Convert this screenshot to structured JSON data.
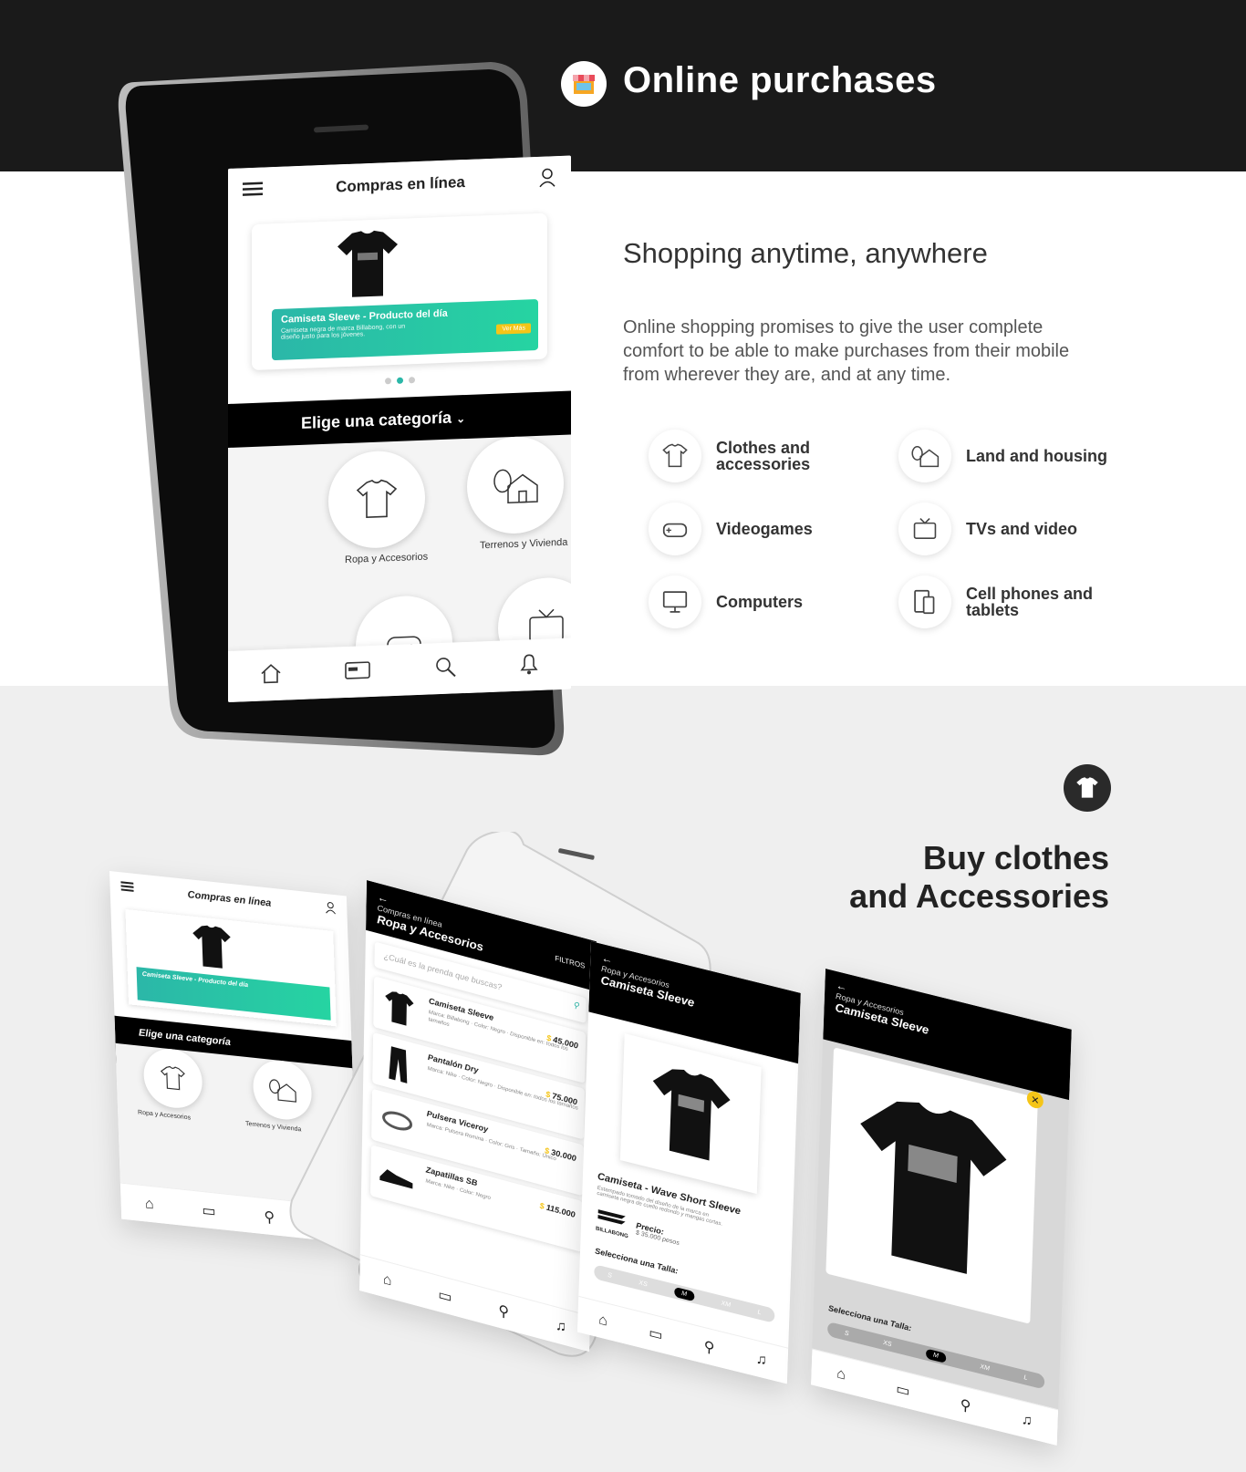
{
  "hero": {
    "title": "Online purchases"
  },
  "intro": {
    "subtitle": "Shopping anytime, anywhere",
    "description": "Online shopping promises to give the user complete comfort to be able to make purchases from their mobile from wherever they are, and at any time."
  },
  "categories": [
    {
      "label": "Clothes and accessories",
      "icon": "tshirt-icon"
    },
    {
      "label": "Land and housing",
      "icon": "house-icon"
    },
    {
      "label": "Videogames",
      "icon": "gamepad-icon"
    },
    {
      "label": "TVs and video",
      "icon": "tv-icon"
    },
    {
      "label": "Computers",
      "icon": "monitor-icon"
    },
    {
      "label": "Cell phones and tablets",
      "icon": "phone-tablet-icon"
    }
  ],
  "app": {
    "title": "Compras en línea",
    "banner": {
      "title": "Camiseta Sleeve - Producto del día",
      "description": "Camiseta negra de marca Billabong, con un diseño justo para los jóvenes.",
      "button": "Ver Más"
    },
    "choose_category": "Elige una categoría",
    "cat_clothes": "Ropa y Accesorios",
    "cat_land": "Terrenos y Vivienda"
  },
  "lower": {
    "title_line1": "Buy clothes",
    "title_line2": "and Accessories"
  },
  "list_screen": {
    "breadcrumb": "Compras en línea",
    "title": "Ropa y Accesorios",
    "filters": "FILTROS",
    "search_placeholder": "¿Cuál es la prenda que buscas?",
    "products": [
      {
        "name": "Camiseta Sleeve",
        "price": "45.000",
        "meta": "Marca: Billabong · Color: Negro · Disponible en: todos los tamaños"
      },
      {
        "name": "Pantalón Dry",
        "price": "75.000",
        "meta": "Marca: Nike · Color: Negro · Disponible en: todos los tamaños"
      },
      {
        "name": "Pulsera Viceroy",
        "price": "30.000",
        "meta": "Marca: Pulsera Romina · Color: Gris · Tamaño: Único"
      },
      {
        "name": "Zapatillas SB",
        "price": "115.000",
        "meta": "Marca: Nike · Color: Negro"
      }
    ]
  },
  "detail_screen": {
    "breadcrumb": "Ropa y Accesorios",
    "title": "Camiseta Sleeve",
    "product_name": "Camiseta - Wave Short Sleeve",
    "product_desc": "Estampado tomado del diseño de la marca en camiseta negra de cuello redondo y mangas cortas.",
    "brand": "BILLABONG",
    "price_label": "Precio:",
    "price_value": "$ 35.000 pesos",
    "size_label": "Selecciona una Talla:",
    "sizes": [
      "S",
      "XS",
      "M",
      "XM",
      "L"
    ],
    "selected_size": "M"
  },
  "colors": {
    "accent": "#2bb7a8",
    "yellow": "#f5c518",
    "dark": "#1a1a1a"
  }
}
